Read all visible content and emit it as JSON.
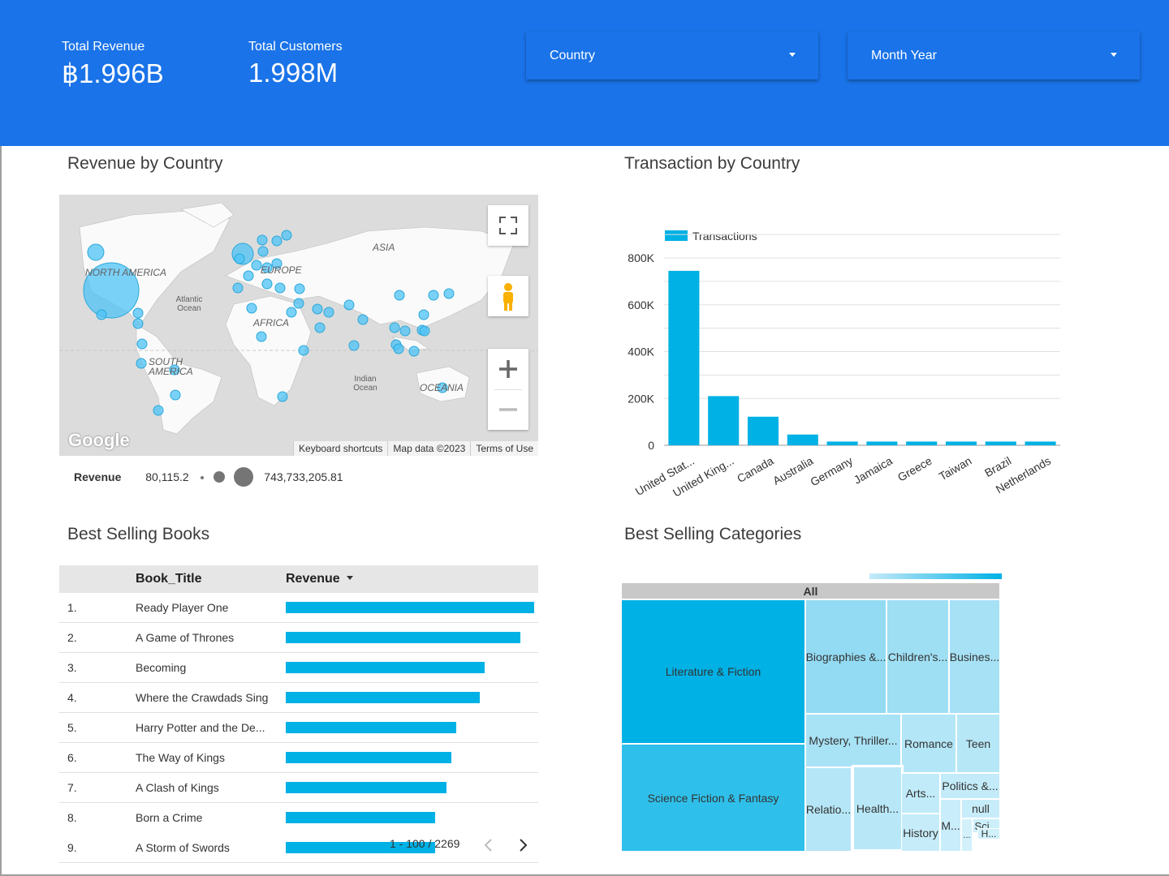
{
  "header": {
    "kpis": [
      {
        "label": "Total Revenue",
        "value": "฿1.996B"
      },
      {
        "label": "Total Customers",
        "value": "1.998M"
      }
    ],
    "filters": [
      {
        "label": "Country"
      },
      {
        "label": "Month Year"
      }
    ]
  },
  "revenue_map": {
    "title": "Revenue by Country",
    "continent_labels": [
      "NORTH AMERICA",
      "ASIA",
      "EUROPE",
      "AFRICA",
      "SOUTH AMERICA",
      "OCEANIA"
    ],
    "ocean_labels": [
      "Atlantic Ocean",
      "Indian Ocean"
    ],
    "footer": [
      "Keyboard shortcuts",
      "Map data ©2023",
      "Terms of Use"
    ],
    "logo": "Google",
    "legend": {
      "label": "Revenue",
      "min": "80,115.2",
      "max": "743,733,205.81"
    }
  },
  "transactions_chart": {
    "title": "Transaction by Country",
    "chart_data": {
      "type": "bar",
      "categories": [
        "United Stat...",
        "United King...",
        "Canada",
        "Australia",
        "Germany",
        "Jamaica",
        "Greece",
        "Taiwan",
        "Brazil",
        "Netherlands"
      ],
      "series": [
        {
          "name": "Transactions",
          "values": [
            745000,
            210000,
            122000,
            46000,
            16000,
            16000,
            16000,
            16000,
            16000,
            16000
          ]
        }
      ],
      "y_ticks": [
        "0",
        "200K",
        "400K",
        "600K",
        "800K"
      ],
      "ylim": [
        0,
        800000
      ],
      "grid": true,
      "legend": "top-left",
      "color": "#00b1e5"
    }
  },
  "best_books": {
    "title": "Best Selling Books",
    "columns": [
      "Book_Title",
      "Revenue"
    ],
    "rows": [
      {
        "rank": "1.",
        "title": "Ready Player One",
        "revenue": 1.0
      },
      {
        "rank": "2.",
        "title": "A Game of Thrones",
        "revenue": 0.946
      },
      {
        "rank": "3.",
        "title": "Becoming",
        "revenue": 0.802
      },
      {
        "rank": "4.",
        "title": "Where the Crawdads Sing",
        "revenue": 0.782
      },
      {
        "rank": "5.",
        "title": "Harry Potter and the De...",
        "revenue": 0.687
      },
      {
        "rank": "6.",
        "title": "The Way of Kings",
        "revenue": 0.667
      },
      {
        "rank": "7.",
        "title": "A Clash of Kings",
        "revenue": 0.648
      },
      {
        "rank": "8.",
        "title": "Born a Crime",
        "revenue": 0.601
      },
      {
        "rank": "9.",
        "title": "A Storm of Swords",
        "revenue": 0.601
      }
    ],
    "pagination": "1 - 100 / 2269"
  },
  "categories_treemap": {
    "title": "Best Selling Categories",
    "root_label": "All",
    "categories": [
      "Literature & Fiction",
      "Science Fiction & Fantasy",
      "Biographies &...",
      "Children's...",
      "Busines...",
      "Mystery, Thriller...",
      "Romance",
      "Teen",
      "Relatio...",
      "Health...",
      "Arts...",
      "Politics &...",
      "null",
      "History",
      "M...",
      "Sci...",
      "H...",
      "..."
    ]
  },
  "colors": {
    "brand": "#1a73e8",
    "bar": "#00b1e5",
    "bubble": "#4fc3f7"
  }
}
